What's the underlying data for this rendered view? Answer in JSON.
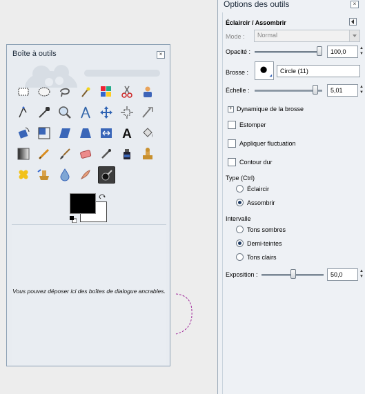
{
  "toolbox": {
    "title": "Boîte à outils",
    "dock_text": "Vous pouvez déposer ici des boîtes de dialogue ancrables.",
    "tools": [
      {
        "icon": "rect-select-icon"
      },
      {
        "icon": "ellipse-select-icon"
      },
      {
        "icon": "lasso-icon"
      },
      {
        "icon": "fuzzy-select-icon"
      },
      {
        "icon": "select-by-color-icon"
      },
      {
        "icon": "scissors-icon"
      },
      {
        "icon": "foreground-select-icon"
      },
      {
        "icon": "paths-icon"
      },
      {
        "icon": "color-picker-icon"
      },
      {
        "icon": "zoom-icon"
      },
      {
        "icon": "measure-icon"
      },
      {
        "icon": "move-icon"
      },
      {
        "icon": "align-icon"
      },
      {
        "icon": "crop-icon"
      },
      {
        "icon": "rotate-icon"
      },
      {
        "icon": "scale-icon"
      },
      {
        "icon": "shear-icon"
      },
      {
        "icon": "perspective-icon"
      },
      {
        "icon": "flip-icon"
      },
      {
        "icon": "text-icon"
      },
      {
        "icon": "bucket-fill-icon"
      },
      {
        "icon": "blend-icon"
      },
      {
        "icon": "pencil-icon"
      },
      {
        "icon": "paintbrush-icon"
      },
      {
        "icon": "eraser-icon"
      },
      {
        "icon": "airbrush-icon"
      },
      {
        "icon": "ink-icon"
      },
      {
        "icon": "clone-icon"
      },
      {
        "icon": "heal-icon"
      },
      {
        "icon": "perspective-clone-icon"
      },
      {
        "icon": "blur-icon"
      },
      {
        "icon": "smudge-icon"
      },
      {
        "icon": "dodge-burn-icon",
        "active": true
      }
    ]
  },
  "options": {
    "title": "Options des outils",
    "tool_name": "Éclaircir / Assombrir",
    "mode_label": "Mode :",
    "mode_value": "Normal",
    "opacity_label": "Opacité :",
    "opacity_value": "100,0",
    "opacity_fraction": 1.0,
    "brush_label": "Brosse :",
    "brush_name": "Circle (11)",
    "scale_label": "Échelle :",
    "scale_value": "5,01",
    "brush_dynamics_label": "Dynamique de la brosse",
    "fade_label": "Estomper",
    "jitter_label": "Appliquer fluctuation",
    "hard_edge_label": "Contour dur",
    "type_label": "Type  (Ctrl)",
    "type_options": [
      "Éclaircir",
      "Assombrir"
    ],
    "type_selected": 1,
    "range_label": "Intervalle",
    "range_options": [
      "Tons sombres",
      "Demi-teintes",
      "Tons clairs"
    ],
    "range_selected": 1,
    "exposure_label": "Exposition :",
    "exposure_value": "50,0"
  },
  "colors": {
    "foreground": "#000000",
    "background": "#ffffff",
    "panel_bg": "#eef1f5"
  }
}
